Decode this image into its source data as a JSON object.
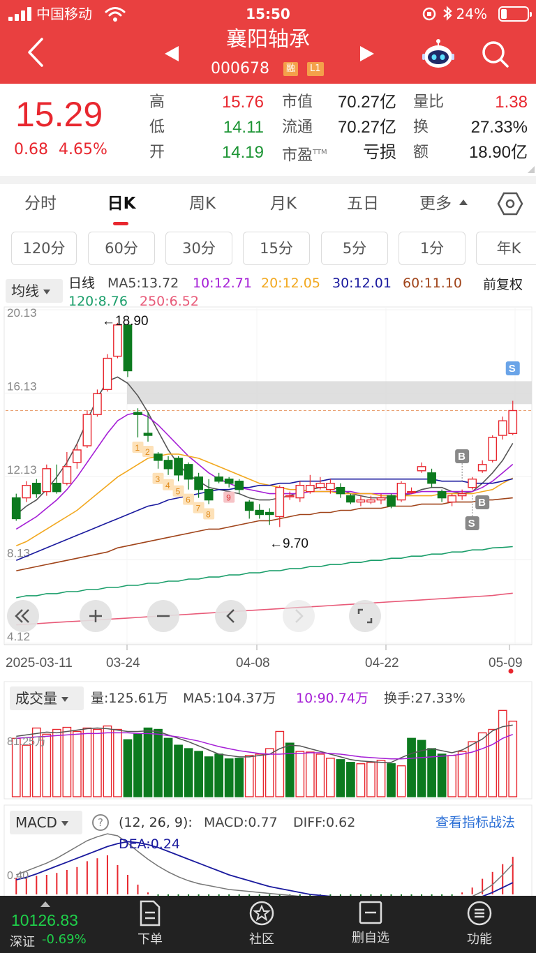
{
  "status_bar": {
    "carrier": "中国移动",
    "time": "15:50",
    "battery": "24%"
  },
  "header": {
    "stock_name": "襄阳轴承",
    "stock_code": "000678",
    "tag_margin": "融",
    "tag_level": "L1"
  },
  "quote": {
    "price": "15.29",
    "change": "0.68",
    "change_pct": "4.65%",
    "high_label": "高",
    "high": "15.76",
    "low_label": "低",
    "low": "14.11",
    "open_label": "开",
    "open": "14.19",
    "mktcap_label": "市值",
    "mktcap": "70.27亿",
    "float_label": "流通",
    "float_cap": "70.27亿",
    "pe_label": "市盈",
    "pe_sup": "TTM",
    "pe": "亏损",
    "volratio_label": "量比",
    "volratio": "1.38",
    "turnover_label": "换",
    "turnover": "27.33%",
    "amount_label": "额",
    "amount": "18.90亿"
  },
  "period_tabs": [
    "分时",
    "日K",
    "周K",
    "月K",
    "五日",
    "更多"
  ],
  "minute_buttons": [
    "120分",
    "60分",
    "30分",
    "15分",
    "5分",
    "1分",
    "年K"
  ],
  "kline": {
    "indicator_chip": "均线",
    "series_label": "日线",
    "ma5": "MA5:13.72",
    "ma10": "10:12.71",
    "ma20": "20:12.05",
    "ma30": "30:12.01",
    "ma60": "60:11.10",
    "ma120": "120:8.76",
    "ma250": "250:6.52",
    "adjust": "前复权",
    "y_ticks": [
      "20.13",
      "16.13",
      "12.13",
      "8.13",
      "4.12"
    ],
    "x_ticks": [
      "2025-03-11",
      "03-24",
      "04-08",
      "04-22",
      "05-09"
    ],
    "high_annotation": "←18.90",
    "low_annotation": "←9.70",
    "nine_turn": [
      "1",
      "2",
      "3",
      "4",
      "5",
      "6",
      "7",
      "8",
      "9"
    ],
    "signals": {
      "b": "B",
      "s": "S"
    }
  },
  "volume": {
    "chip": "成交量",
    "vol": "量:125.61万",
    "ma5": "MA5:104.37万",
    "ma10": "10:90.74万",
    "turnover": "换手:27.33%",
    "axis_label": "81.25万"
  },
  "macd": {
    "chip": "MACD",
    "help": "?",
    "params": "(12, 26, 9):",
    "macd": "MACD:0.77",
    "diff": "DIFF:0.62",
    "dea": "DEA:0.24",
    "strategy_link": "查看指标战法",
    "axis_label": "0.40"
  },
  "bottom_bar": {
    "index_value": "10126.83",
    "index_name": "深证",
    "index_change": "-0.69%",
    "nav": [
      "下单",
      "社区",
      "删自选",
      "功能"
    ]
  },
  "colors": {
    "header_bg": "#e94040",
    "up": "#e8272f",
    "down": "#0c7a1f",
    "ma5": "#555555",
    "ma10": "#a51fd6",
    "ma20": "#f2a81f",
    "ma30": "#1a1a9e",
    "ma60": "#a0441a",
    "ma120": "#1a9e6a",
    "ma250": "#e85a78"
  },
  "chart_data": {
    "type": "candlestick",
    "title": "",
    "dates": [
      "2025-03-11",
      "03-24",
      "04-08",
      "04-22",
      "05-09"
    ],
    "candles": [
      [
        11.1,
        10.1,
        11.3,
        10.0
      ],
      [
        11.1,
        11.7,
        11.9,
        10.9
      ],
      [
        11.8,
        11.3,
        12.0,
        11.1
      ],
      [
        11.4,
        12.5,
        12.7,
        11.2
      ],
      [
        11.8,
        11.4,
        12.7,
        11.3
      ],
      [
        11.8,
        12.6,
        13.3,
        11.7
      ],
      [
        12.8,
        13.4,
        13.7,
        12.5
      ],
      [
        13.6,
        15.1,
        15.3,
        13.5
      ],
      [
        15.1,
        16.1,
        16.3,
        15.0
      ],
      [
        16.3,
        17.8,
        18.0,
        16.2
      ],
      [
        17.9,
        19.4,
        19.5,
        17.8
      ],
      [
        19.4,
        17.2,
        18.9,
        16.9
      ],
      [
        15.2,
        15.1,
        15.4,
        14.0
      ],
      [
        14.2,
        14.1,
        15.2,
        13.8
      ],
      [
        13.2,
        12.9,
        13.3,
        12.5
      ],
      [
        12.9,
        12.5,
        13.1,
        12.2
      ],
      [
        13.0,
        12.2,
        13.1,
        11.9
      ],
      [
        12.7,
        12.0,
        12.8,
        11.5
      ],
      [
        12.1,
        11.5,
        12.3,
        11.1
      ],
      [
        11.5,
        11.0,
        12.0,
        10.8
      ],
      [
        12.1,
        11.9,
        12.3,
        11.8
      ],
      [
        12.0,
        11.8,
        12.1,
        11.6
      ],
      [
        11.9,
        11.5,
        12.0,
        11.3
      ],
      [
        10.9,
        10.5,
        11.0,
        10.1
      ],
      [
        10.5,
        10.3,
        10.8,
        10.1
      ],
      [
        10.4,
        10.3,
        10.6,
        9.8
      ],
      [
        10.2,
        11.6,
        11.7,
        9.7
      ],
      [
        11.2,
        11.2,
        11.4,
        11.0
      ],
      [
        11.1,
        11.7,
        11.9,
        10.9
      ],
      [
        11.4,
        11.7,
        12.2,
        11.3
      ],
      [
        11.6,
        11.8,
        12.1,
        11.5
      ],
      [
        11.5,
        11.8,
        12.0,
        11.3
      ],
      [
        11.6,
        11.3,
        11.8,
        11.1
      ],
      [
        11.2,
        10.9,
        11.3,
        10.8
      ],
      [
        10.9,
        11.0,
        11.2,
        10.7
      ],
      [
        10.9,
        11.0,
        11.2,
        10.8
      ],
      [
        11.0,
        11.1,
        11.3,
        10.8
      ],
      [
        11.2,
        10.7,
        11.3,
        10.6
      ],
      [
        11.0,
        11.8,
        11.9,
        10.9
      ],
      [
        11.4,
        11.4,
        11.6,
        11.3
      ],
      [
        12.4,
        12.6,
        12.8,
        12.3
      ],
      [
        12.3,
        11.8,
        12.5,
        11.6
      ],
      [
        11.4,
        11.1,
        11.5,
        10.9
      ],
      [
        10.9,
        11.2,
        11.3,
        10.7
      ],
      [
        11.2,
        11.3,
        11.5,
        11.0
      ],
      [
        11.6,
        12.0,
        12.1,
        11.5
      ],
      [
        12.4,
        12.7,
        12.9,
        12.3
      ],
      [
        12.9,
        14.0,
        14.1,
        12.8
      ],
      [
        14.1,
        14.8,
        15.0,
        13.9
      ],
      [
        14.19,
        15.29,
        15.76,
        14.11
      ]
    ],
    "volumes": [
      85,
      75,
      100,
      91,
      98,
      101,
      95,
      100,
      98,
      103,
      98,
      83,
      91,
      100,
      98,
      85,
      75,
      70,
      66,
      58,
      62,
      55,
      56,
      60,
      62,
      70,
      95,
      78,
      66,
      65,
      62,
      56,
      54,
      50,
      48,
      50,
      53,
      48,
      45,
      85,
      82,
      70,
      62,
      60,
      66,
      80,
      93,
      98,
      125.61,
      110
    ],
    "volume_up_flags": [
      1,
      1,
      1,
      1,
      1,
      1,
      1,
      1,
      1,
      1,
      1,
      0,
      0,
      0,
      0,
      0,
      0,
      0,
      0,
      0,
      0,
      0,
      0,
      1,
      1,
      1,
      1,
      0,
      1,
      1,
      1,
      1,
      0,
      0,
      1,
      1,
      1,
      0,
      1,
      0,
      0,
      0,
      0,
      1,
      1,
      1,
      1,
      1,
      1,
      1
    ],
    "ma": {
      "MA5": [
        10.3,
        10.7,
        11.0,
        11.5,
        12.1,
        12.8,
        13.7,
        14.8,
        15.9,
        16.7,
        16.9,
        16.6,
        16.0,
        15.2,
        14.3,
        13.4,
        12.7,
        12.2,
        11.9,
        11.6,
        11.5,
        11.4,
        11.3,
        11.1,
        11.0,
        11.0,
        11.1,
        11.2,
        11.4,
        11.5,
        11.6,
        11.6,
        11.5,
        11.3,
        11.2,
        11.1,
        11.1,
        11.1,
        11.2,
        11.3,
        11.5,
        11.6,
        11.6,
        11.4,
        11.3,
        11.4,
        11.8,
        12.3,
        12.9,
        13.72
      ],
      "MA10": [
        9.6,
        9.9,
        10.2,
        10.6,
        11.0,
        11.5,
        12.1,
        12.8,
        13.5,
        14.2,
        14.8,
        15.1,
        15.2,
        15.0,
        14.6,
        14.1,
        13.6,
        13.1,
        12.7,
        12.3,
        12.0,
        11.8,
        11.6,
        11.5,
        11.4,
        11.3,
        11.3,
        11.3,
        11.3,
        11.4,
        11.4,
        11.4,
        11.4,
        11.4,
        11.3,
        11.3,
        11.3,
        11.3,
        11.3,
        11.3,
        11.4,
        11.4,
        11.4,
        11.4,
        11.4,
        11.4,
        11.6,
        11.9,
        12.3,
        12.71
      ],
      "MA20": [
        8.8,
        9.0,
        9.3,
        9.6,
        9.9,
        10.2,
        10.5,
        10.9,
        11.3,
        11.7,
        12.1,
        12.4,
        12.7,
        13.0,
        13.1,
        13.2,
        13.2,
        13.1,
        13.0,
        12.8,
        12.6,
        12.4,
        12.2,
        12.0,
        11.8,
        11.7,
        11.6,
        11.5,
        11.5,
        11.4,
        11.4,
        11.4,
        11.3,
        11.3,
        11.3,
        11.3,
        11.2,
        11.2,
        11.2,
        11.2,
        11.2,
        11.2,
        11.3,
        11.3,
        11.3,
        11.3,
        11.4,
        11.5,
        11.8,
        12.05
      ],
      "MA30": [
        8.1,
        8.3,
        8.5,
        8.7,
        8.9,
        9.1,
        9.3,
        9.5,
        9.7,
        9.9,
        10.1,
        10.3,
        10.5,
        10.7,
        10.8,
        11.0,
        11.1,
        11.2,
        11.3,
        11.4,
        11.5,
        11.5,
        11.6,
        11.6,
        11.7,
        11.7,
        11.8,
        11.8,
        11.9,
        11.9,
        11.9,
        12.0,
        12.0,
        12.0,
        12.0,
        12.0,
        12.0,
        12.0,
        12.0,
        12.0,
        12.0,
        12.0,
        11.9,
        11.9,
        11.9,
        11.8,
        11.8,
        11.8,
        11.9,
        12.01
      ],
      "MA60": [
        7.6,
        7.7,
        7.8,
        7.9,
        8.0,
        8.1,
        8.2,
        8.3,
        8.4,
        8.5,
        8.7,
        8.8,
        8.9,
        9.0,
        9.1,
        9.2,
        9.3,
        9.4,
        9.5,
        9.6,
        9.6,
        9.7,
        9.8,
        9.9,
        10.0,
        10.0,
        10.1,
        10.2,
        10.3,
        10.3,
        10.4,
        10.4,
        10.5,
        10.5,
        10.6,
        10.6,
        10.6,
        10.7,
        10.7,
        10.7,
        10.8,
        10.8,
        10.8,
        10.9,
        10.9,
        10.9,
        11.0,
        11.0,
        11.05,
        11.1
      ],
      "MA120": [
        6.3,
        6.4,
        6.4,
        6.5,
        6.5,
        6.6,
        6.6,
        6.7,
        6.7,
        6.8,
        6.8,
        6.9,
        6.9,
        7.0,
        7.0,
        7.1,
        7.1,
        7.2,
        7.2,
        7.3,
        7.3,
        7.4,
        7.4,
        7.5,
        7.5,
        7.6,
        7.6,
        7.7,
        7.7,
        7.8,
        7.8,
        7.9,
        7.9,
        8.0,
        8.0,
        8.1,
        8.1,
        8.2,
        8.2,
        8.3,
        8.3,
        8.4,
        8.4,
        8.5,
        8.5,
        8.6,
        8.6,
        8.7,
        8.72,
        8.76
      ],
      "MA250": [
        5.0,
        5.03,
        5.06,
        5.09,
        5.12,
        5.15,
        5.18,
        5.21,
        5.24,
        5.27,
        5.3,
        5.33,
        5.36,
        5.39,
        5.42,
        5.45,
        5.48,
        5.51,
        5.54,
        5.57,
        5.6,
        5.63,
        5.66,
        5.69,
        5.72,
        5.75,
        5.78,
        5.81,
        5.84,
        5.87,
        5.9,
        5.93,
        5.96,
        5.99,
        6.02,
        6.05,
        6.08,
        6.11,
        6.14,
        6.17,
        6.2,
        6.23,
        6.26,
        6.29,
        6.32,
        6.35,
        6.38,
        6.41,
        6.47,
        6.52
      ]
    },
    "volume_ma": {
      "MA5": [
        88,
        90,
        92,
        94,
        93,
        95,
        97,
        99,
        100,
        99,
        97,
        95,
        95,
        96,
        95,
        90,
        85,
        80,
        74,
        68,
        62,
        60,
        58,
        58,
        60,
        62,
        70,
        75,
        74,
        70,
        66,
        62,
        58,
        54,
        52,
        51,
        50,
        50,
        57,
        63,
        67,
        70,
        67,
        64,
        68,
        76,
        84,
        96,
        102,
        104.37
      ],
      "MA10": [
        85,
        86,
        87,
        88,
        89,
        90,
        91,
        92,
        92,
        93,
        93,
        93,
        92,
        92,
        91,
        89,
        87,
        84,
        81,
        77,
        73,
        70,
        67,
        65,
        63,
        62,
        62,
        63,
        63,
        64,
        64,
        63,
        62,
        60,
        58,
        57,
        56,
        55,
        55,
        56,
        57,
        58,
        59,
        60,
        62,
        65,
        70,
        76,
        85,
        90.74
      ]
    },
    "macd": {
      "hist": [
        0.34,
        0.36,
        0.38,
        0.4,
        0.44,
        0.5,
        0.56,
        0.68,
        0.74,
        0.8,
        0.6,
        0.4,
        0.2,
        0.04,
        -0.1,
        -0.2,
        -0.28,
        -0.32,
        -0.34,
        -0.34,
        -0.3,
        -0.28,
        -0.26,
        -0.26,
        -0.24,
        -0.22,
        -0.18,
        -0.16,
        -0.14,
        -0.12,
        -0.1,
        -0.09,
        -0.09,
        -0.09,
        -0.09,
        -0.09,
        -0.08,
        -0.08,
        -0.07,
        -0.06,
        -0.06,
        -0.05,
        -0.05,
        -0.04,
        0.04,
        0.14,
        0.32,
        0.46,
        0.62,
        0.77
      ],
      "diff": [
        0.4,
        0.48,
        0.56,
        0.64,
        0.74,
        0.86,
        0.98,
        1.1,
        1.18,
        1.24,
        1.2,
        1.05,
        0.88,
        0.72,
        0.58,
        0.46,
        0.36,
        0.28,
        0.22,
        0.18,
        0.14,
        0.1,
        0.08,
        0.06,
        0.04,
        0.02,
        0.0,
        -0.02,
        -0.04,
        -0.06,
        -0.08,
        -0.1,
        -0.12,
        -0.13,
        -0.14,
        -0.15,
        -0.15,
        -0.15,
        -0.15,
        -0.15,
        -0.14,
        -0.13,
        -0.12,
        -0.1,
        -0.08,
        -0.04,
        0.06,
        0.2,
        0.4,
        0.62
      ],
      "dea": [
        0.3,
        0.35,
        0.42,
        0.5,
        0.58,
        0.66,
        0.74,
        0.82,
        0.9,
        0.98,
        1.04,
        1.08,
        1.06,
        1.02,
        0.96,
        0.88,
        0.8,
        0.72,
        0.64,
        0.56,
        0.48,
        0.4,
        0.34,
        0.28,
        0.22,
        0.16,
        0.12,
        0.08,
        0.04,
        0.0,
        -0.02,
        -0.04,
        -0.06,
        -0.08,
        -0.09,
        -0.1,
        -0.1,
        -0.1,
        -0.1,
        -0.1,
        -0.1,
        -0.1,
        -0.1,
        -0.1,
        -0.09,
        -0.08,
        -0.04,
        0.04,
        0.14,
        0.24
      ]
    },
    "price_range": [
      4.12,
      20.13
    ],
    "dashed_ref_line": 15.29,
    "ylabel": "",
    "legend": "top-left"
  }
}
